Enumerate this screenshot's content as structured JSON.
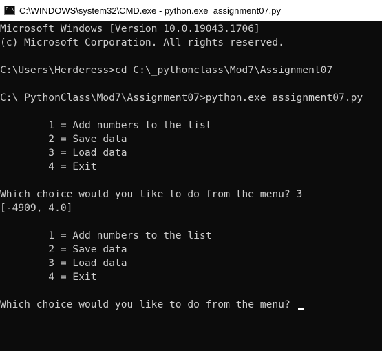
{
  "window": {
    "title": "C:\\WINDOWS\\system32\\CMD.exe - python.exe  assignment07.py",
    "icon": "cmd-icon"
  },
  "console": {
    "lines": [
      "Microsoft Windows [Version 10.0.19043.1706]",
      "(c) Microsoft Corporation. All rights reserved.",
      "",
      "C:\\Users\\Herderess>cd C:\\_pythonclass\\Mod7\\Assignment07",
      "",
      "C:\\_PythonClass\\Mod7\\Assignment07>python.exe assignment07.py",
      "",
      "        1 = Add numbers to the list",
      "        2 = Save data",
      "        3 = Load data",
      "        4 = Exit",
      "",
      "Which choice would you like to do from the menu? 3",
      "[-4909, 4.0]",
      "",
      "        1 = Add numbers to the list",
      "        2 = Save data",
      "        3 = Load data",
      "        4 = Exit",
      "",
      "Which choice would you like to do from the menu? "
    ]
  }
}
